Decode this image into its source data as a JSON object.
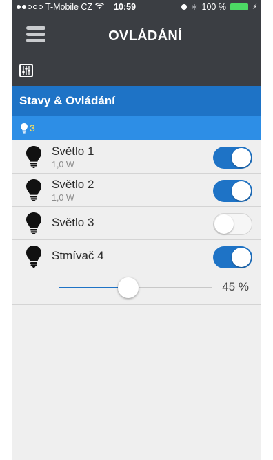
{
  "status_bar": {
    "carrier": "T-Mobile CZ",
    "time": "10:59",
    "battery": "100 %",
    "signal_full": 2,
    "signal_total": 5,
    "wifi_icon": "wifi-icon",
    "bluetooth_icon": "bluetooth-icon"
  },
  "header": {
    "title": "OVLÁDÁNÍ",
    "menu_icon": "hamburger-menu-icon"
  },
  "toolbar": {
    "icon": "mixer-controls-icon"
  },
  "section": {
    "title": "Stavy & Ovládání",
    "bulb_count": "3"
  },
  "devices": [
    {
      "name": "Světlo 1",
      "power": "1,0 W",
      "on": true
    },
    {
      "name": "Světlo 2",
      "power": "1,0 W",
      "on": true
    },
    {
      "name": "Světlo 3",
      "power": "",
      "on": false
    },
    {
      "name": "Stmívač 4",
      "power": "",
      "on": true
    }
  ],
  "dimmer": {
    "value_label": "45 %",
    "percent": 45
  },
  "colors": {
    "dark_bar": "#3b3e43",
    "accent_blue": "#1e73c6",
    "light_blue": "#2d8ee6",
    "count_yellow": "#ffe25a",
    "battery_green": "#4cd964",
    "list_bg": "#efefef"
  }
}
